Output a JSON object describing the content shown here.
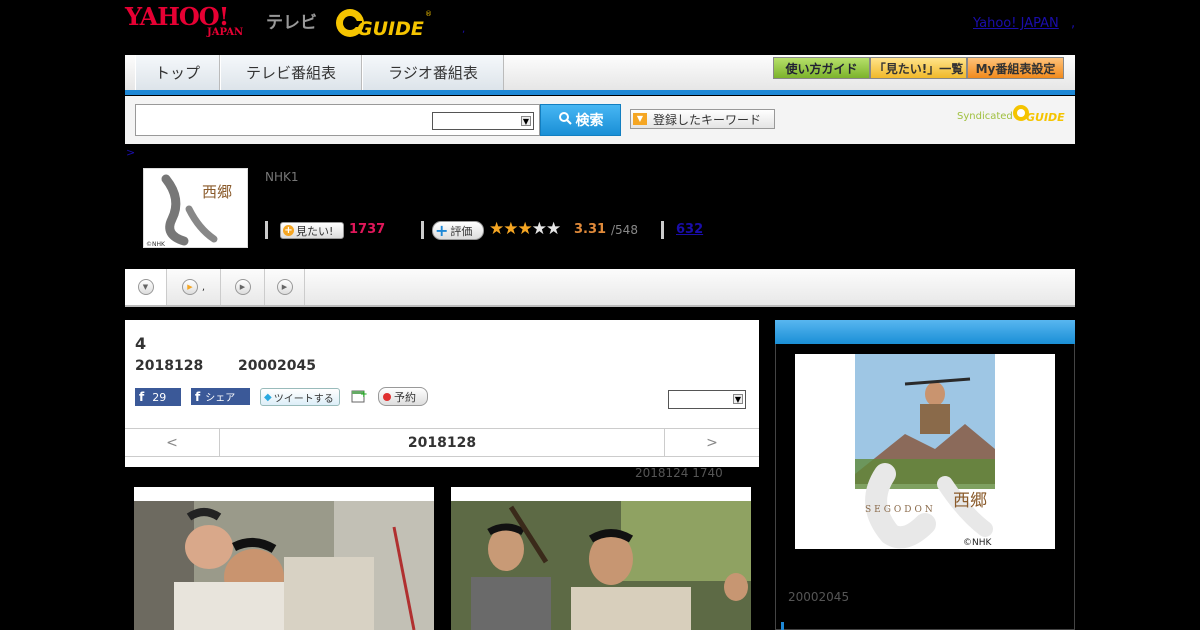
{
  "header": {
    "logo_yahoo": "YAHOO!",
    "logo_japan": "JAPAN",
    "logo_tv": "テレビ",
    "logo_gguide": "GUIDE",
    "yahoo_link": "Yahoo! JAPAN",
    "dot": ","
  },
  "nav": {
    "tabs": [
      {
        "label": "トップ"
      },
      {
        "label": "テレビ番組表"
      },
      {
        "label": "ラジオ番組表"
      }
    ],
    "guide_btn": "使い方ガイド",
    "mitai_list_btn": "「見たい!」一覧",
    "my_schedule_btn": "My番組表設定"
  },
  "search": {
    "input_value": "",
    "button_label": "検索",
    "keyword_btn": "登録したキーワード",
    "syndicated": "Syndicated"
  },
  "breadcrumb": ">",
  "program": {
    "channel": "NHK1",
    "thumb_title": "西郷",
    "thumb_copyright": "©NHK",
    "mitai_label": "見たい!",
    "mitai_count": "1737",
    "hyoka_label": "評価",
    "rating": "3.31",
    "rating_total": "/548",
    "rating_stars": 3,
    "review_count": "632"
  },
  "tabstrip": {
    "tab2_label": ","
  },
  "episode": {
    "number": "4",
    "date": "2018128",
    "time": "20002045",
    "fb_count": "29",
    "share_label": "シェア",
    "tweet_label": "ツイートする",
    "yoyaku_label": "予約",
    "prev": "<",
    "nav_date": "2018128",
    "next": ">",
    "update_note": "2018124  1740"
  },
  "side": {
    "poster_title": "西郷",
    "poster_sub": "SEGODON",
    "poster_copyright": "©NHK",
    "time": "20002045"
  },
  "colors": {
    "accent": "#1e88d6",
    "brand_red": "#e60033",
    "mitai_pink": "#e0175a",
    "star": "#f5a623"
  }
}
